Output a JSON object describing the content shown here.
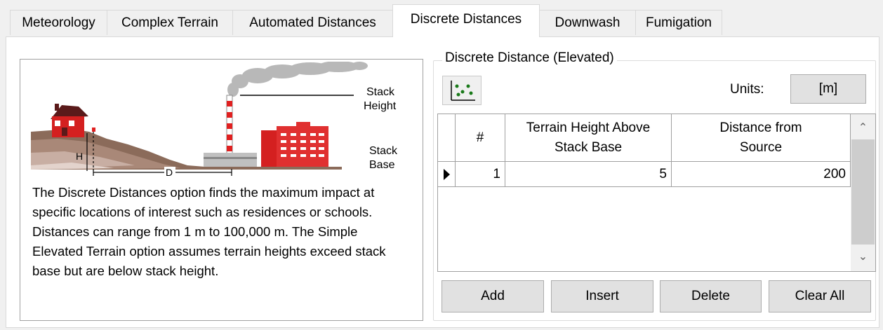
{
  "tabs": [
    {
      "label": "Meteorology"
    },
    {
      "label": "Complex Terrain"
    },
    {
      "label": "Automated Distances"
    },
    {
      "label": "Discrete Distances"
    },
    {
      "label": "Downwash"
    },
    {
      "label": "Fumigation"
    }
  ],
  "illustration": {
    "stack_height_label_line1": "Stack",
    "stack_height_label_line2": "Height",
    "stack_base_label_line1": "Stack",
    "stack_base_label_line2": "Base",
    "h_label": "H",
    "d_label": "D"
  },
  "description": "The Discrete Distances option finds the maximum impact at specific locations of interest such as residences or schools. Distances can range from 1 m to 100,000 m.  The Simple Elevated Terrain option assumes terrain heights exceed stack base but are below stack height.",
  "group": {
    "title": "Discrete Distance (Elevated)",
    "units_label": "Units:",
    "units_value": "[m]",
    "scatter_icon": "scatter-plot-icon"
  },
  "grid": {
    "columns": [
      "#",
      "Terrain Height Above Stack Base",
      "Distance from Source"
    ],
    "rows": [
      {
        "num": "1",
        "terrain_height": "5",
        "distance": "200"
      }
    ]
  },
  "buttons": {
    "add": "Add",
    "insert": "Insert",
    "delete": "Delete",
    "clear_all": "Clear All"
  },
  "colors": {
    "accent_red": "#e02020",
    "smoke_gray": "#b8b8b8",
    "terrain_brown": "#8b6b5a"
  }
}
